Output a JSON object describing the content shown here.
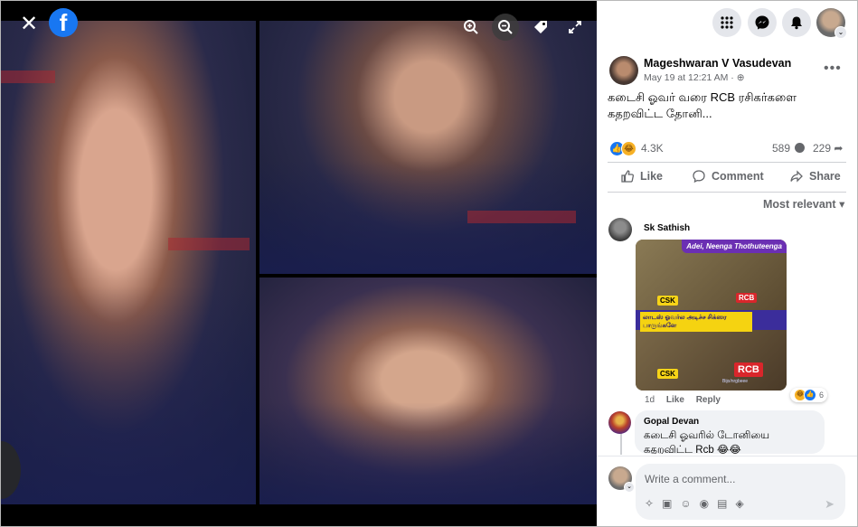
{
  "viewer": {
    "close_icon": "close-icon",
    "logo_letter": "f",
    "zoom_in_icon": "zoom-in-icon",
    "zoom_out_icon": "zoom-out-icon",
    "tag_icon": "tag-icon",
    "fullscreen_icon": "fullscreen-icon"
  },
  "header": {
    "menu_icon": "grid-menu-icon",
    "messenger_icon": "messenger-icon",
    "notifications_icon": "bell-icon"
  },
  "post": {
    "author": "Mageshwaran V Vasudevan",
    "time": "May 19 at 12:21 AM · ",
    "text": "கடைசி ஓவர் வரை RCB ரசிகர்களை கதறவிட்ட தோனி...",
    "reactions_count": "4.3K",
    "comments_count": "589",
    "shares_count": "229",
    "actions": {
      "like": "Like",
      "comment": "Comment",
      "share": "Share"
    },
    "sort_label": "Most relevant"
  },
  "comments": [
    {
      "author": "Sk Sathish",
      "meme": {
        "banner": "Adei, Neenga Thothuteenga",
        "tamil_caption": "லாடஸ் ஓவர்ல அடிச்ச சிக்ஸர பாருங்களே",
        "tag_csk": "CSK",
        "tag_rcb": "RCB",
        "watermark": "Bijo/nrgbeee"
      },
      "age": "1d",
      "like": "Like",
      "reply": "Reply",
      "reaction_count": "6"
    },
    {
      "author": "Gopal Devan",
      "text": "கடைசி ஓவரில் டோனியை கதறவிட்ட Rcb 😂😂"
    }
  ],
  "composer": {
    "placeholder": "Write a comment...",
    "send_icon": "send-icon"
  },
  "colors": {
    "brand": "#1877f2",
    "viewer_bg": "#000000",
    "muted": "#65676b"
  }
}
